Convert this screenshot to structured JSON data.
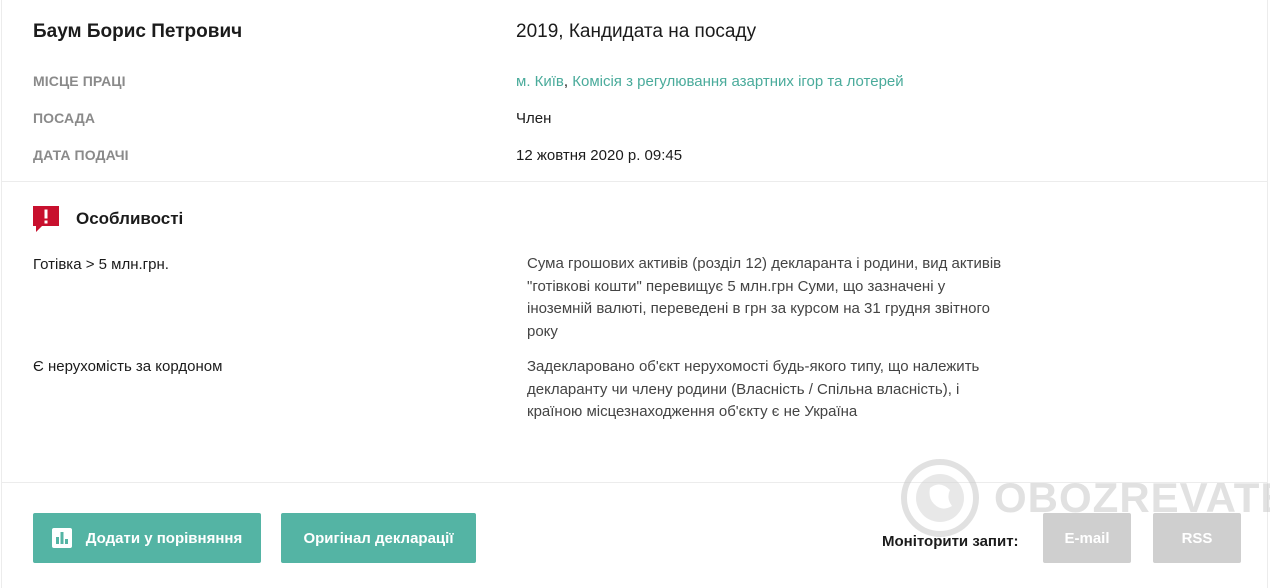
{
  "person": {
    "name": "Баум Борис Петрович",
    "declaration_type": "2019, Кандидата на посаду"
  },
  "details": [
    {
      "label": "МІСЦЕ ПРАЦІ"
    },
    {
      "label": "ПОСАДА",
      "value": "Член"
    },
    {
      "label": "ДАТА ПОДАЧІ",
      "value": "12 жовтня 2020 р. 09:45"
    }
  ],
  "workplace": {
    "city_link": "м. Київ",
    "separator": ",",
    "org_link": "Комісія з регулювання азартних ігор та лотерей"
  },
  "features": {
    "title": "Особливості",
    "icon": "exclamation-flag-icon",
    "items": [
      {
        "name": "Готівка > 5 млн.грн.",
        "description": "Сума грошових активів (розділ 12) декларанта і родини, вид активів \"готівкові кошти\" перевищує 5 млн.грн Суми, що зазначені у іноземній валюті, переведені в грн за курсом на 31 грудня звітного року"
      },
      {
        "name": "Є нерухомість за кордоном",
        "description": "Задекларовано об'єкт нерухомості будь-якого типу, що належить декларанту чи члену родини (Власність / Спільна власність), і країною місцезнаходження об'єкту є не Україна"
      }
    ]
  },
  "actions": {
    "compare_label": "Додати у порівняння",
    "compare_icon": "bar-chart-icon",
    "original_label": "Оригінал декларації",
    "monitor_label": "Моніторити запит:",
    "email_label": "E-mail",
    "rss_label": "RSS"
  },
  "watermark": {
    "text": "OBOZREVATEL"
  },
  "colors": {
    "accent": "#54b4a4",
    "link": "#4aab9b",
    "alert": "#c8102e",
    "disabled": "#cfcfcf",
    "label": "#8a8a8a"
  }
}
